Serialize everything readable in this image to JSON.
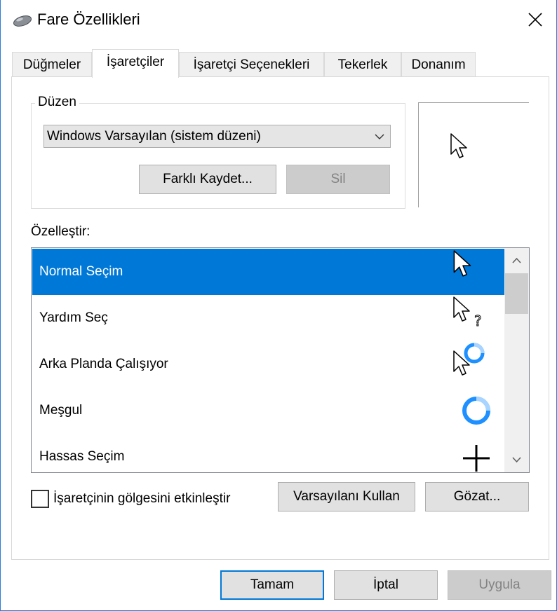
{
  "window": {
    "title": "Fare Özellikleri"
  },
  "tabs": [
    {
      "label": "Düğmeler"
    },
    {
      "label": "İşaretçiler"
    },
    {
      "label": "İşaretçi Seçenekleri"
    },
    {
      "label": "Tekerlek"
    },
    {
      "label": "Donanım"
    }
  ],
  "scheme": {
    "legend": "Düzen",
    "selected": "Windows Varsayılan (sistem düzeni)",
    "save_as_label": "Farklı Kaydet...",
    "delete_label": "Sil"
  },
  "customize": {
    "label": "Özelleştir:",
    "items": [
      {
        "label": "Normal Seçim",
        "icon": "arrow-cursor-icon"
      },
      {
        "label": "Yardım Seç",
        "icon": "help-cursor-icon"
      },
      {
        "label": "Arka Planda Çalışıyor",
        "icon": "working-background-cursor-icon"
      },
      {
        "label": "Meşgul",
        "icon": "busy-cursor-icon"
      },
      {
        "label": "Hassas Seçim",
        "icon": "precision-cursor-icon"
      }
    ],
    "selected_index": 0
  },
  "shadow_checkbox": {
    "label": "İşaretçinin gölgesini etkinleştir",
    "checked": false
  },
  "use_default_label": "Varsayılanı Kullan",
  "browse_label": "Gözat...",
  "footer": {
    "ok_label": "Tamam",
    "cancel_label": "İptal",
    "apply_label": "Uygula"
  },
  "colors": {
    "selection": "#0078d7",
    "busy_ring": "#1e90ff"
  }
}
